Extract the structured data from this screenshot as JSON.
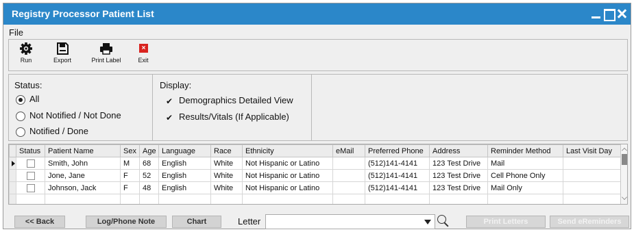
{
  "window": {
    "title": "Registry Processor Patient List"
  },
  "menu": {
    "file": "File"
  },
  "toolbar": [
    {
      "label": "Run",
      "icon": "gear-icon"
    },
    {
      "label": "Export",
      "icon": "save-icon"
    },
    {
      "label": "Print Label",
      "icon": "printer-icon"
    },
    {
      "label": "Exit",
      "icon": "exit-icon"
    }
  ],
  "status": {
    "label": "Status:",
    "options": [
      {
        "label": "All",
        "selected": true
      },
      {
        "label": "Not Notified / Not Done",
        "selected": false
      },
      {
        "label": "Notified / Done",
        "selected": false
      }
    ]
  },
  "display": {
    "label": "Display:",
    "options": [
      {
        "label": "Demographics Detailed View",
        "checked": true
      },
      {
        "label": "Results/Vitals (If Applicable)",
        "checked": true
      }
    ]
  },
  "grid": {
    "columns": [
      "Status",
      "Patient Name",
      "Sex",
      "Age",
      "Language",
      "Race",
      "Ethnicity",
      "eMail",
      "Preferred Phone",
      "Address",
      "Reminder Method",
      "Last Visit Day"
    ],
    "rows": [
      {
        "name": "Smith, John",
        "sex": "M",
        "age": "68",
        "language": "English",
        "race": "White",
        "ethnicity": "Not Hispanic or Latino",
        "email": "",
        "phone": "(512)141-4141",
        "address": "123 Test Drive",
        "reminder": "Mail",
        "last_visit": ""
      },
      {
        "name": "Jone, Jane",
        "sex": "F",
        "age": "52",
        "language": "English",
        "race": "White",
        "ethnicity": "Not Hispanic or Latino",
        "email": "",
        "phone": "(512)141-4141",
        "address": "123 Test Drive",
        "reminder": "Cell Phone Only",
        "last_visit": ""
      },
      {
        "name": "Johnson, Jack",
        "sex": "F",
        "age": "48",
        "language": "English",
        "race": "White",
        "ethnicity": "Not Hispanic or Latino",
        "email": "",
        "phone": "(512)141-4141",
        "address": "123 Test Drive",
        "reminder": "Mail Only",
        "last_visit": ""
      }
    ]
  },
  "footer": {
    "back": "<< Back",
    "log_note": "Log/Phone Note",
    "chart": "Chart",
    "letter_label": "Letter",
    "letter_value": "",
    "print_letters": "Print Letters",
    "send_reminders": "Send eReminders"
  },
  "colors": {
    "titlebar": "#2b87c9",
    "exit_red": "#d9231f"
  }
}
